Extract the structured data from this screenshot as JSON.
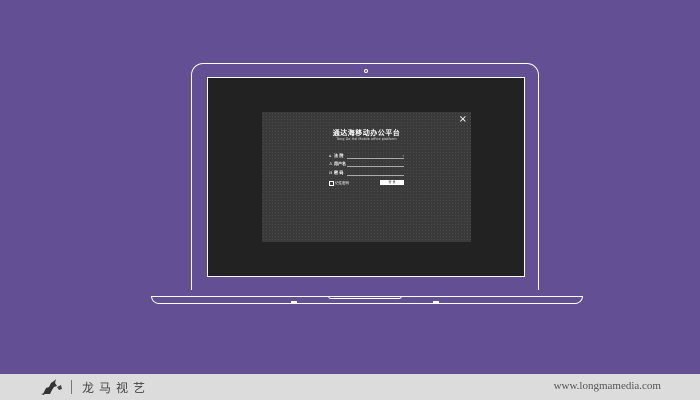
{
  "dialog": {
    "title": "通达海移动办公平台",
    "subtitle": "Tong Da Hai Mobile office platform",
    "close_glyph": "×",
    "fields": [
      {
        "icon": "home-icon",
        "glyph": "⌂",
        "label": "法 院",
        "value": "",
        "chevron": "‹"
      },
      {
        "icon": "user-icon",
        "glyph": "♙",
        "label": "用户名",
        "value": ""
      },
      {
        "icon": "lock-icon",
        "glyph": "⊟",
        "label": "密 码",
        "value": ""
      }
    ],
    "remember_label": "记住密码",
    "login_label": "登 录"
  },
  "footer": {
    "brand_name": "龙马视艺",
    "url": "www.longmamedia.com"
  },
  "colors": {
    "background": "#634f94",
    "screen": "#222222",
    "dialog": "#3a3a3a",
    "footer": "#dcdcdc"
  }
}
